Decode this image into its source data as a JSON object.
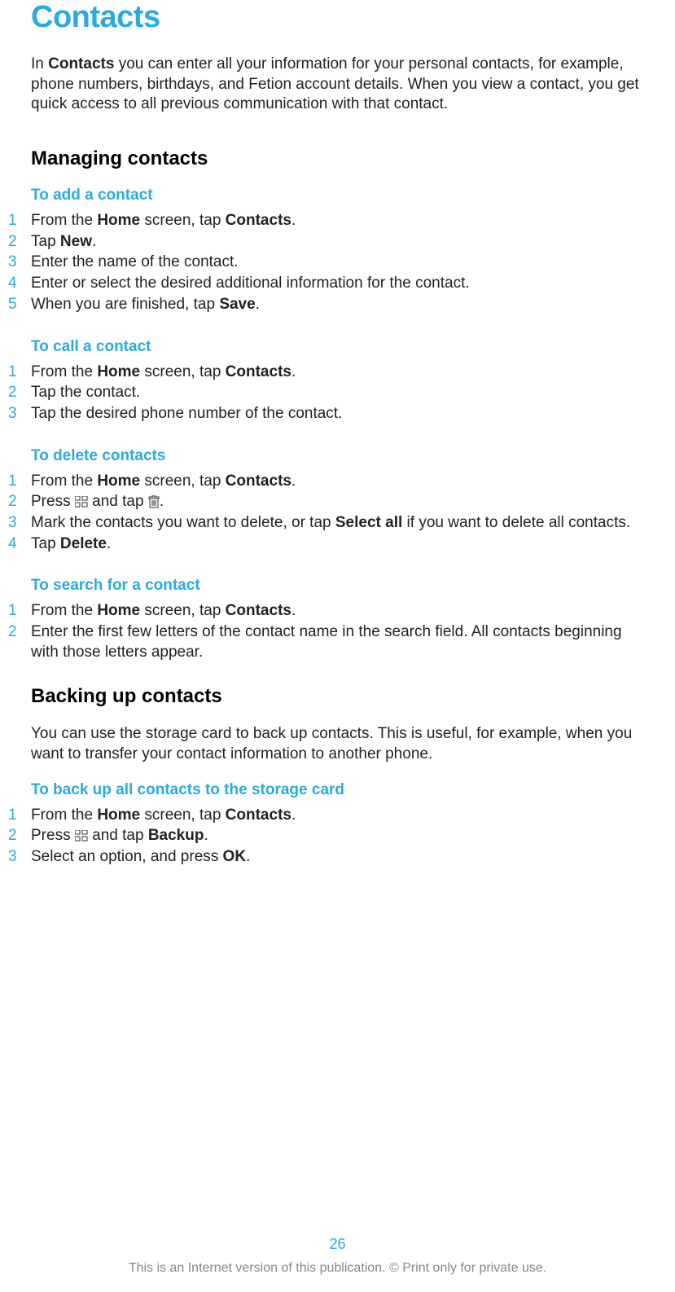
{
  "title": "Contacts",
  "intro": {
    "prefix": "In ",
    "bold1": "Contacts",
    "rest": " you can enter all your information for your personal contacts, for example, phone numbers, birthdays, and Fetion account details. When you view a contact, you get quick access to all previous communication with that contact."
  },
  "section1": {
    "heading": "Managing contacts",
    "sub1": {
      "title": "To add a contact",
      "steps": [
        {
          "n": "1",
          "parts": [
            "From the ",
            "Home",
            " screen, tap ",
            "Contacts",
            "."
          ]
        },
        {
          "n": "2",
          "parts": [
            "Tap ",
            "New",
            "."
          ]
        },
        {
          "n": "3",
          "text": "Enter the name of the contact."
        },
        {
          "n": "4",
          "text": "Enter or select the desired additional information for the contact."
        },
        {
          "n": "5",
          "parts": [
            "When you are finished, tap ",
            "Save",
            "."
          ]
        }
      ]
    },
    "sub2": {
      "title": "To call a contact",
      "steps": [
        {
          "n": "1",
          "parts": [
            "From the ",
            "Home",
            " screen, tap ",
            "Contacts",
            "."
          ]
        },
        {
          "n": "2",
          "text": "Tap the contact."
        },
        {
          "n": "3",
          "text": "Tap the desired phone number of the contact."
        }
      ]
    },
    "sub3": {
      "title": "To delete contacts",
      "steps": [
        {
          "n": "1",
          "parts": [
            "From the ",
            "Home",
            " screen, tap ",
            "Contacts",
            "."
          ]
        },
        {
          "n": "2",
          "press": "Press ",
          "andtap": " and tap  ",
          "end": "."
        },
        {
          "n": "3",
          "parts": [
            "Mark the contacts you want to delete, or tap ",
            "Select all",
            " if you want to delete all contacts."
          ]
        },
        {
          "n": "4",
          "parts": [
            "Tap ",
            "Delete",
            "."
          ]
        }
      ]
    },
    "sub4": {
      "title": "To search for a contact",
      "steps": [
        {
          "n": "1",
          "parts": [
            "From the ",
            "Home",
            " screen, tap ",
            "Contacts",
            "."
          ]
        },
        {
          "n": "2",
          "text": "Enter the first few letters of the contact name in the search field. All contacts beginning with those letters appear."
        }
      ]
    }
  },
  "section2": {
    "heading": "Backing up contacts",
    "body": "You can use the storage card to back up contacts. This is useful, for example, when you want to transfer your contact information to another phone.",
    "sub1": {
      "title": "To back up all contacts to the storage card",
      "steps": [
        {
          "n": "1",
          "parts": [
            "From the ",
            "Home",
            " screen, tap ",
            "Contacts",
            "."
          ]
        },
        {
          "n": "2",
          "press": "Press ",
          "andtap": " and tap ",
          "bold": "Backup",
          "end": "."
        },
        {
          "n": "3",
          "parts": [
            "Select an option, and press ",
            "OK",
            "."
          ]
        }
      ]
    }
  },
  "footer": {
    "pageNumber": "26",
    "text": "This is an Internet version of this publication. © Print only for private use."
  }
}
